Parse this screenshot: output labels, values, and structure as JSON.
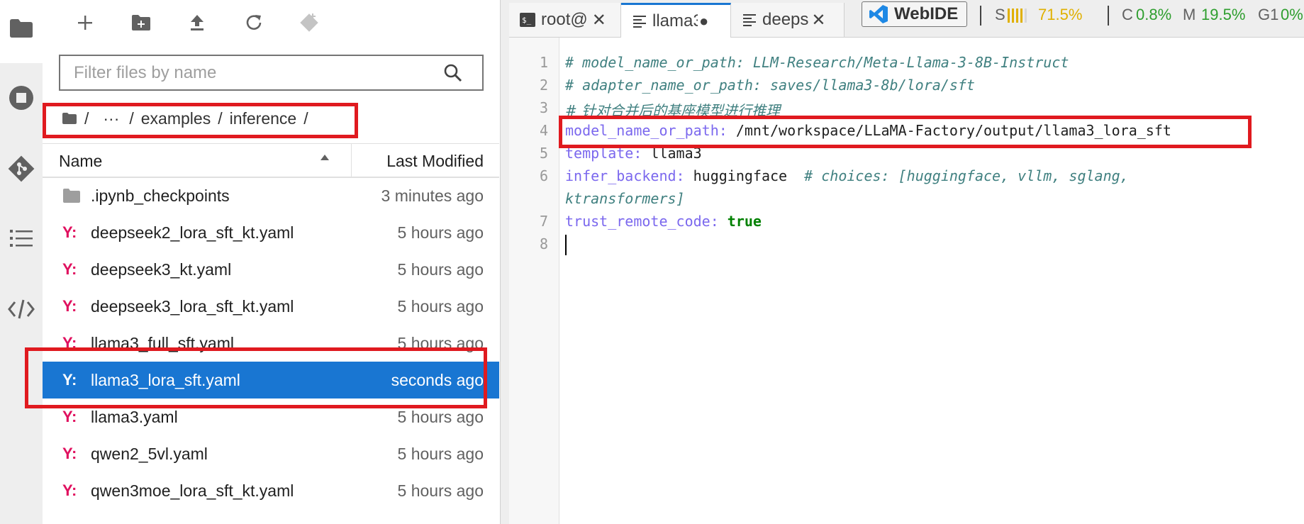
{
  "activity_bar": {
    "icons": [
      "folder-icon",
      "stop-circle-icon",
      "git-icon",
      "list-icon",
      "code-icon"
    ]
  },
  "file_browser": {
    "toolbar": [
      "new-launcher-icon",
      "new-folder-icon",
      "upload-icon",
      "refresh-icon",
      "git-clone-icon"
    ],
    "filter_placeholder": "Filter files by name",
    "breadcrumb": {
      "root": "/",
      "ellipsis": "···",
      "sep1": "/",
      "part1": "examples",
      "sep2": "/",
      "part2": "inference",
      "sep3": "/"
    },
    "columns": {
      "name": "Name",
      "modified": "Last Modified"
    },
    "files": [
      {
        "name": ".ipynb_checkpoints",
        "modified": "3 minutes ago",
        "type": "folder"
      },
      {
        "name": "deepseek2_lora_sft_kt.yaml",
        "modified": "5 hours ago",
        "type": "yaml"
      },
      {
        "name": "deepseek3_kt.yaml",
        "modified": "5 hours ago",
        "type": "yaml"
      },
      {
        "name": "deepseek3_lora_sft_kt.yaml",
        "modified": "5 hours ago",
        "type": "yaml"
      },
      {
        "name": "llama3_full_sft.yaml",
        "modified": "5 hours ago",
        "type": "yaml"
      },
      {
        "name": "llama3_lora_sft.yaml",
        "modified": "seconds ago",
        "type": "yaml",
        "selected": true
      },
      {
        "name": "llama3.yaml",
        "modified": "5 hours ago",
        "type": "yaml"
      },
      {
        "name": "qwen2_5vl.yaml",
        "modified": "5 hours ago",
        "type": "yaml"
      },
      {
        "name": "qwen3moe_lora_sft_kt.yaml",
        "modified": "5 hours ago",
        "type": "yaml"
      }
    ],
    "yaml_icon_text": "Y:"
  },
  "tabs": [
    {
      "label": "root@",
      "icon": "terminal-icon",
      "close": "✕"
    },
    {
      "label": "llama3",
      "icon": "text-file-icon",
      "close": "●"
    },
    {
      "label": "deeps",
      "icon": "text-file-icon",
      "close": "✕"
    }
  ],
  "webide_label": "WebIDE",
  "status": {
    "s_label": "S",
    "s_value": "71.5%",
    "c_label": "C",
    "c_value": "0.8%",
    "m_label": "M",
    "m_value": "19.5%",
    "g_label": "G1",
    "g_value": "0%"
  },
  "editor": {
    "line_numbers": [
      "1",
      "2",
      "3",
      "4",
      "5",
      "6",
      "7",
      "8"
    ],
    "lines": {
      "l1": "# model_name_or_path: LLM-Research/Meta-Llama-3-8B-Instruct",
      "l2": "# adapter_name_or_path: saves/llama3-8b/lora/sft",
      "l3": "# 针对合并后的基座模型进行推理",
      "l4_key": "model_name_or_path:",
      "l4_val": " /mnt/workspace/LLaMA-Factory/output/llama3_lora_sft",
      "l5_key": "template:",
      "l5_val": " llama3",
      "l6_key": "infer_backend:",
      "l6_val": " huggingface  ",
      "l6_comment": "# choices: [huggingface, vllm, sglang,",
      "l6_wrap": "ktransformers]",
      "l7_key": "trust_remote_code:",
      "l7_val": "true"
    }
  },
  "colors": {
    "highlight_box": "#e01a1f",
    "selection": "#1976d2",
    "yaml_icon": "#e0115f",
    "status_yellow": "#e0b000",
    "status_green": "#2e9e2e"
  }
}
